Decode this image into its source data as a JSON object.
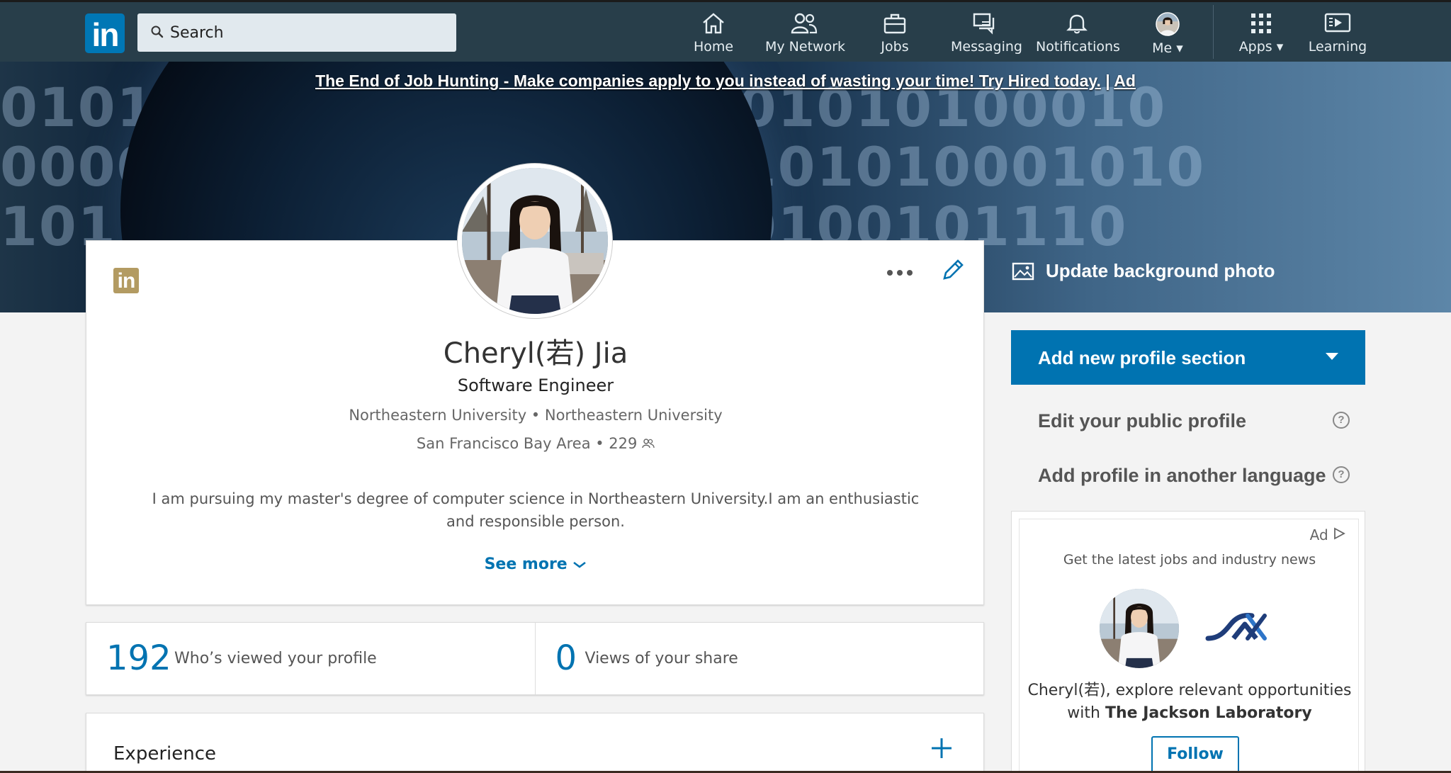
{
  "nav": {
    "search_placeholder": "Search",
    "items": [
      {
        "label": "Home",
        "icon": "home-icon"
      },
      {
        "label": "My Network",
        "icon": "network-icon"
      },
      {
        "label": "Jobs",
        "icon": "briefcase-icon"
      },
      {
        "label": "Messaging",
        "icon": "messaging-icon"
      },
      {
        "label": "Notifications",
        "icon": "bell-icon"
      },
      {
        "label": "Me",
        "icon": "avatar"
      },
      {
        "label": "Apps",
        "icon": "grid-icon"
      },
      {
        "label": "Learning",
        "icon": "learning-icon"
      }
    ],
    "logo_text": "in"
  },
  "banner": {
    "ad_text": "The End of Job Hunting - Make companies apply to you instead of wasting your time! Try Hired today.",
    "ad_sep": " | ",
    "ad_label": "Ad",
    "bits_row1": "010101101011100000101010100010",
    "bits_row2": "0000101010100010101101010001010",
    "bits_row3": "10110110100101001010100101110",
    "update_bg": "Update background photo"
  },
  "profile": {
    "badge": "in",
    "name": "Cheryl(若) Jia",
    "headline": "Software Engineer",
    "education": "Northeastern University • Northeastern University",
    "location": "San Francisco Bay Area • 229",
    "about": "I am pursuing my master's degree of computer science in Northeastern University.I am an enthusiastic and responsible person.",
    "see_more": "See more"
  },
  "stats": [
    {
      "value": "192",
      "label": "Who’s viewed your profile"
    },
    {
      "value": "0",
      "label": "Views of your share"
    }
  ],
  "experience": {
    "title": "Experience"
  },
  "rail": {
    "add_section": "Add new profile section",
    "edit_public": "Edit your public profile",
    "add_language": "Add profile in another language",
    "help": "?"
  },
  "ad": {
    "tag": "Ad",
    "news": "Get the latest jobs and industry news",
    "text_prefix": "Cheryl(若), explore relevant opportunities with ",
    "company": "The Jackson Laboratory",
    "follow": "Follow"
  },
  "colors": {
    "nav_bg": "#283e4a",
    "accent": "#0073b1",
    "premium_gold": "#b39b62"
  }
}
